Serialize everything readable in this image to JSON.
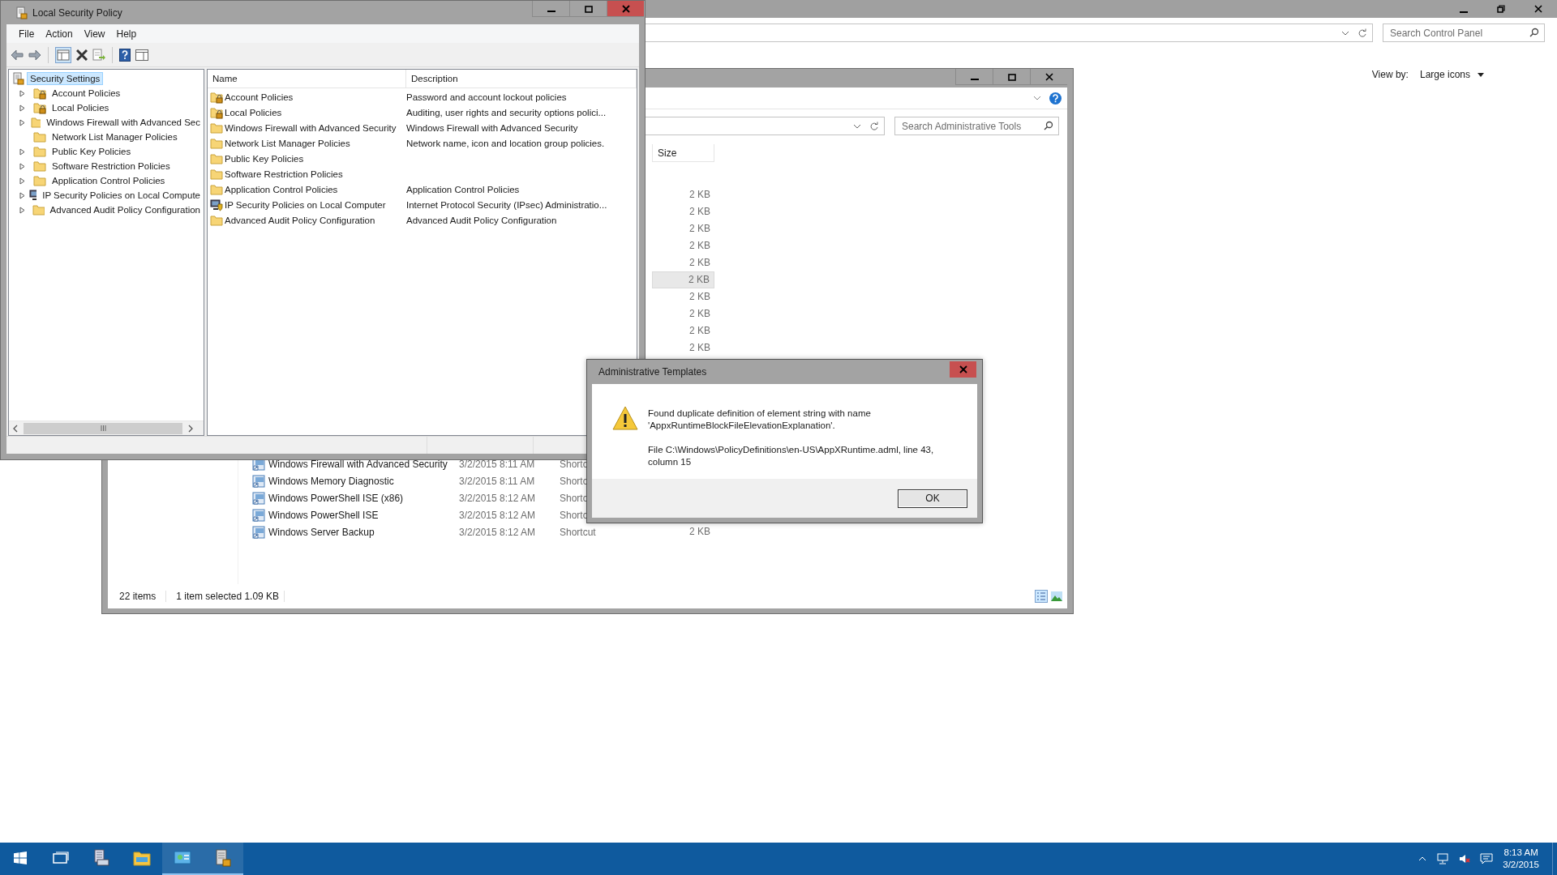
{
  "control_panel": {
    "search": {
      "placeholder": "Search Control Panel"
    },
    "view_by": {
      "label": "View by:",
      "value": "Large icons"
    }
  },
  "admin_tools": {
    "search": {
      "placeholder": "Search Administrative Tools"
    },
    "size_header": "Size",
    "upper_rows": [
      {
        "size": "2 KB",
        "selected": false
      },
      {
        "size": "2 KB",
        "selected": false
      },
      {
        "size": "2 KB",
        "selected": false
      },
      {
        "size": "2 KB",
        "selected": false
      },
      {
        "size": "2 KB",
        "selected": false
      },
      {
        "size": "2 KB",
        "selected": true
      },
      {
        "size": "2 KB",
        "selected": false
      },
      {
        "size": "2 KB",
        "selected": false
      },
      {
        "size": "2 KB",
        "selected": false
      },
      {
        "size": "2 KB",
        "selected": false
      }
    ],
    "lower_rows": [
      {
        "name": "Windows Firewall with Advanced Security",
        "date": "3/2/2015 8:11 AM",
        "type": "Shortc",
        "selected": false
      },
      {
        "name": "Windows Memory Diagnostic",
        "date": "3/2/2015 8:11 AM",
        "type": "Shortc",
        "selected": false
      },
      {
        "name": "Windows PowerShell ISE (x86)",
        "date": "3/2/2015 8:12 AM",
        "type": "Shortc",
        "selected": false
      },
      {
        "name": "Windows PowerShell ISE",
        "date": "3/2/2015 8:12 AM",
        "type": "Shortc",
        "selected": false
      },
      {
        "name": "Windows Server Backup",
        "date": "3/2/2015 8:12 AM",
        "type": "Shortcut",
        "size": "2 KB",
        "selected": false
      }
    ],
    "status": {
      "count": "22 items",
      "selection": "1 item selected  1.09 KB"
    }
  },
  "lsp": {
    "title": "Local Security Policy",
    "menu": [
      "File",
      "Action",
      "View",
      "Help"
    ],
    "tree": {
      "root": {
        "label": "Security Settings",
        "selected": true
      },
      "children": [
        {
          "label": "Account Policies",
          "kind": "folder-lock",
          "expandable": true,
          "selected": false
        },
        {
          "label": "Local Policies",
          "kind": "folder-lock",
          "expandable": true,
          "selected": false
        },
        {
          "label": "Windows Firewall with Advanced Sec",
          "kind": "folder",
          "expandable": true,
          "selected": false
        },
        {
          "label": "Network List Manager Policies",
          "kind": "folder",
          "expandable": false,
          "selected": false
        },
        {
          "label": "Public Key Policies",
          "kind": "folder",
          "expandable": true,
          "selected": false
        },
        {
          "label": "Software Restriction Policies",
          "kind": "folder",
          "expandable": true,
          "selected": false
        },
        {
          "label": "Application Control Policies",
          "kind": "folder",
          "expandable": true,
          "selected": false
        },
        {
          "label": "IP Security Policies on Local Compute",
          "kind": "computer",
          "expandable": true,
          "selected": false
        },
        {
          "label": "Advanced Audit Policy Configuration",
          "kind": "folder",
          "expandable": true,
          "selected": false
        }
      ]
    },
    "columns": [
      "Name",
      "Description"
    ],
    "rows": [
      {
        "name": "Account Policies",
        "kind": "folder-lock",
        "description": "Password and account lockout policies"
      },
      {
        "name": "Local Policies",
        "kind": "folder-lock",
        "description": "Auditing, user rights and security options polici..."
      },
      {
        "name": "Windows Firewall with Advanced Security",
        "kind": "folder",
        "description": "Windows Firewall with Advanced Security"
      },
      {
        "name": "Network List Manager Policies",
        "kind": "folder",
        "description": "Network name, icon and location group policies."
      },
      {
        "name": "Public Key Policies",
        "kind": "folder"
      },
      {
        "name": "Software Restriction Policies",
        "kind": "folder"
      },
      {
        "name": "Application Control Policies",
        "kind": "folder",
        "description": "Application Control Policies"
      },
      {
        "name": "IP Security Policies on Local Computer",
        "kind": "computer",
        "description": "Internet Protocol Security (IPsec) Administratio..."
      },
      {
        "name": "Advanced Audit Policy Configuration",
        "kind": "folder",
        "description": "Advanced Audit Policy Configuration"
      }
    ]
  },
  "dialog": {
    "title": "Administrative Templates",
    "message": "Found duplicate definition of element string with name 'AppxRuntimeBlockFileElevationExplanation'.",
    "detail": "File C:\\Windows\\PolicyDefinitions\\en-US\\AppXRuntime.adml, line 43,\ncolumn 15",
    "button": "OK"
  },
  "taskbar": {
    "apps": [
      {
        "kind": "start",
        "open": false
      },
      {
        "kind": "task-view",
        "open": false
      },
      {
        "kind": "server",
        "open": false
      },
      {
        "kind": "folder",
        "open": false
      },
      {
        "kind": "control-panel",
        "open": true
      },
      {
        "kind": "policy",
        "open": true
      }
    ],
    "time": "8:13 AM",
    "date": "3/2/2015"
  }
}
